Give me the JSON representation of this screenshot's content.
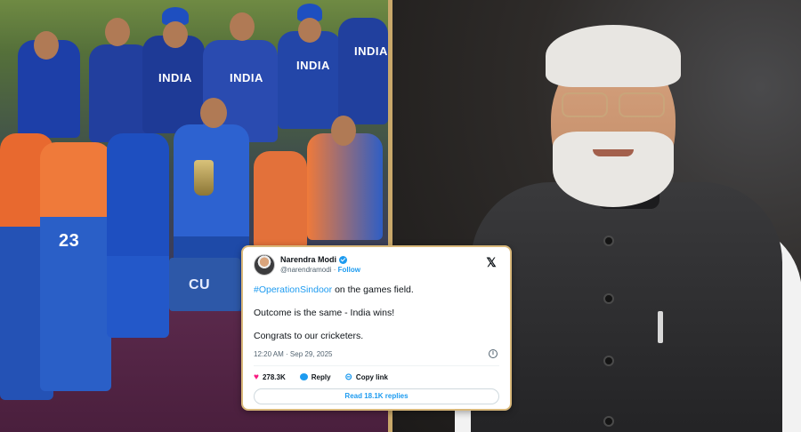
{
  "left_photo": {
    "jersey_labels": [
      "INDIA",
      "INDIA",
      "INDIA",
      "INDIA"
    ],
    "number_label": "23",
    "stage_label": "CU"
  },
  "tweet": {
    "author_name": "Narendra Modi",
    "handle": "@narendramodi",
    "separator": "·",
    "follow_label": "Follow",
    "hashtag": "#OperationSindoor",
    "line1_rest": " on the games field.",
    "line2": "Outcome is the same - India wins!",
    "line3": "Congrats to our cricketers.",
    "timestamp": "12:20 AM · Sep 29, 2025",
    "likes": "278.3K",
    "reply_label": "Reply",
    "copy_link_label": "Copy link",
    "read_replies_label": "Read 18.1K replies"
  },
  "icons": {
    "close": "x-logo-icon",
    "like": "heart-icon",
    "reply": "reply-icon",
    "link": "link-icon",
    "info": "info-icon",
    "verified": "verified-badge-icon"
  },
  "colors": {
    "accent": "#1d9bf0",
    "like": "#f91880",
    "card_border": "#d9b87a"
  }
}
